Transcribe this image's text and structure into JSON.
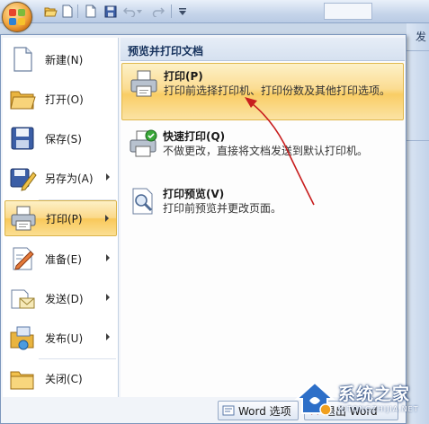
{
  "menu": {
    "items": [
      {
        "label": "新建(N)",
        "icon": "new-document-icon",
        "has_submenu": false
      },
      {
        "label": "打开(O)",
        "icon": "open-folder-icon",
        "has_submenu": false
      },
      {
        "label": "保存(S)",
        "icon": "save-disk-icon",
        "has_submenu": false
      },
      {
        "label": "另存为(A)",
        "icon": "save-as-icon",
        "has_submenu": true
      },
      {
        "label": "打印(P)",
        "icon": "printer-icon",
        "has_submenu": true,
        "selected": true
      },
      {
        "label": "准备(E)",
        "icon": "prepare-icon",
        "has_submenu": true
      },
      {
        "label": "发送(D)",
        "icon": "send-icon",
        "has_submenu": true
      },
      {
        "label": "发布(U)",
        "icon": "publish-icon",
        "has_submenu": true
      },
      {
        "label": "关闭(C)",
        "icon": "close-folder-icon",
        "has_submenu": false
      }
    ]
  },
  "submenu": {
    "header": "预览并打印文档",
    "items": [
      {
        "title": "打印(P)",
        "desc": "打印前选择打印机、打印份数及其他打印选项。",
        "icon": "printer-icon",
        "selected": true
      },
      {
        "title": "快速打印(Q)",
        "desc": "不做更改，直接将文档发送到默认打印机。",
        "icon": "quick-print-icon"
      },
      {
        "title": "打印预览(V)",
        "desc": "打印前预览并更改页面。",
        "icon": "print-preview-icon"
      }
    ]
  },
  "bottom": {
    "options_label": "Word 选项",
    "exit_label": "退出 Word"
  },
  "qat": {
    "partial_text": "发"
  },
  "watermark": {
    "text": "系统之家",
    "url": "XITONGZHIJIA.NET"
  },
  "colors": {
    "highlight": "#f9c85a",
    "menu_bg": "#f1f4f9",
    "header_text": "#15315c",
    "annotation": "#c81e1e"
  }
}
